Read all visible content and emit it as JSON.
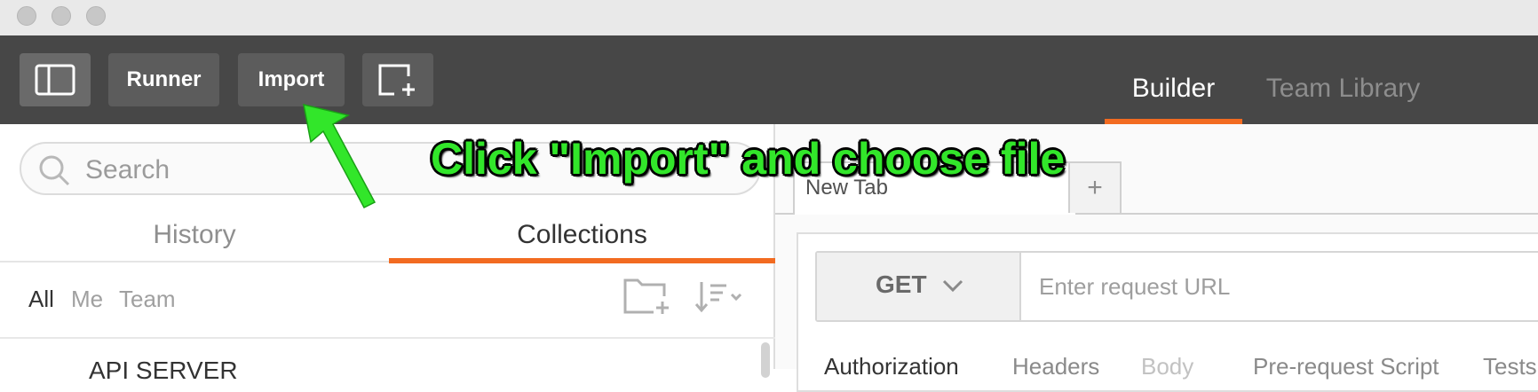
{
  "toolbar": {
    "runner_label": "Runner",
    "import_label": "Import",
    "builder_label": "Builder",
    "team_library_label": "Team Library"
  },
  "sidebar": {
    "search_placeholder": "Search",
    "tabs": [
      "History",
      "Collections"
    ],
    "filters": [
      "All",
      "Me",
      "Team"
    ],
    "first_item_partial": "API SERVER"
  },
  "main": {
    "request_tab_label": "New Tab",
    "add_tab_label": "+",
    "method": "GET",
    "url_placeholder": "Enter request URL",
    "subtabs": [
      "Authorization",
      "Headers",
      "Body",
      "Pre-request Script",
      "Tests"
    ]
  },
  "annotation": {
    "text": "Click \"Import\" and choose file"
  },
  "colors": {
    "accent": "#f26b21",
    "toolbar_bg": "#474747",
    "annotation_green": "#32e62a"
  }
}
